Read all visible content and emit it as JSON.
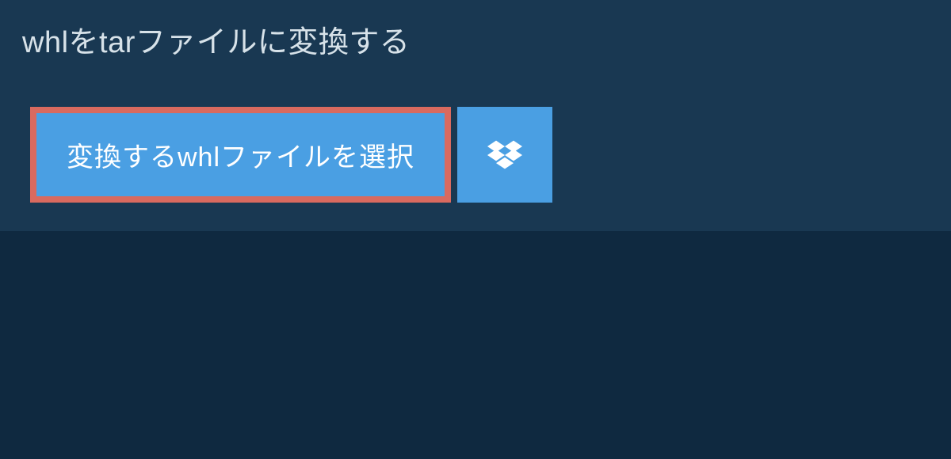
{
  "header": {
    "title": "whlをtarファイルに変換する"
  },
  "actions": {
    "select_file_label": "変換するwhlファイルを選択"
  }
}
